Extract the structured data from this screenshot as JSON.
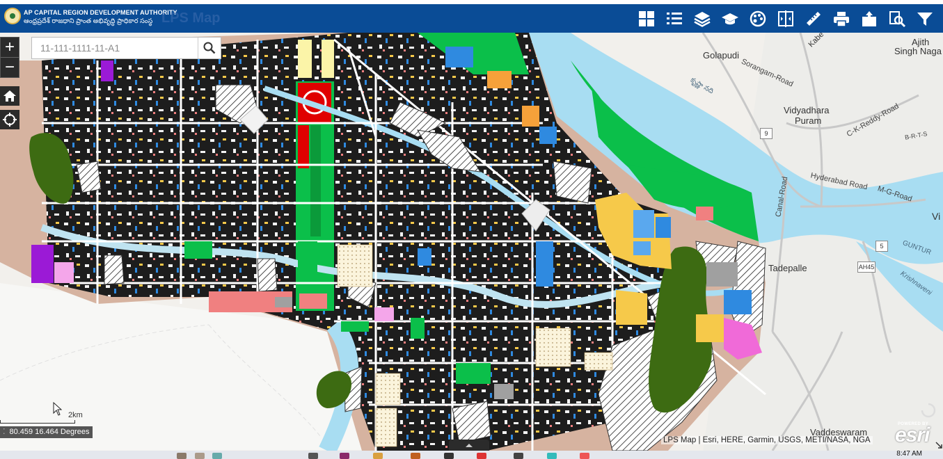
{
  "header": {
    "org_title": "AP CAPITAL REGION DEVELOPMENT AUTHORITY",
    "org_subtitle": "ఆంధ్రప్రదేశ్ రాజధాని ప్రాంత అభివృద్ధి ప్రాధికార సంస్థ",
    "app_name": "LPS Map",
    "tools": [
      {
        "name": "basemap-gallery-icon"
      },
      {
        "name": "legend-list-icon"
      },
      {
        "name": "layers-icon"
      },
      {
        "name": "education-cap-icon"
      },
      {
        "name": "palette-icon"
      },
      {
        "name": "swipe-compare-icon"
      },
      {
        "name": "measure-ruler-icon"
      },
      {
        "name": "print-icon"
      },
      {
        "name": "bookmark-download-icon"
      },
      {
        "name": "query-search-icon"
      },
      {
        "name": "filter-icon"
      }
    ]
  },
  "search": {
    "placeholder": "11-111-1111-11-A1"
  },
  "zoom": {
    "in_label": "+",
    "out_label": "−"
  },
  "places": {
    "golapudi": "Golapudi",
    "ajith": "Ajith",
    "singh_nagar": "Singh Naga",
    "vidyadhara": "Vidyadhara",
    "puram": "Puram",
    "tadepalle": "Tadepalle",
    "vaddeswaram": "Vaddeswaram",
    "vi": "Vi",
    "guntur": "GUNTUR",
    "krishnaveni": "Krishnaveni",
    "kabela": "Kabe",
    "river_name": "కృష్ణా నది"
  },
  "roads": {
    "sorangam": "Sorangam-Road",
    "ck_reddy": "C-K-Reddy-Road",
    "brts": "B-R-T-S",
    "hyderabad": "Hyderabad Road",
    "mg": "M-G-Road",
    "canal": "Canal-Road"
  },
  "shields": {
    "nh9": "9",
    "nh5": "5",
    "ah45": "AH45"
  },
  "scale": {
    "label": "2km"
  },
  "coordinates": {
    "text": "80.459 16.464 Degrees"
  },
  "attribution": "LPS Map | Esri, HERE, Garmin, USGS, METI/NASA, NGA",
  "esri": {
    "powered": "POWERED BY",
    "word": "esri"
  },
  "taskbar": {
    "clock": "8:47 AM"
  },
  "colors": {
    "header": "#0a4c96",
    "river": "#a8ddf2",
    "green_space": "#0bbf4a",
    "dark_forest": "#3d6b12",
    "residential_dense": "#222222",
    "commercial_blue": "#2f8ae0",
    "yellow_zone": "#f6c94a",
    "salmon_zone": "#f08080",
    "tan_zone": "#d6b3a0",
    "purple_zone": "#9b1ad6",
    "pink_zone": "#f06ad8",
    "red_core": "#e00000"
  }
}
